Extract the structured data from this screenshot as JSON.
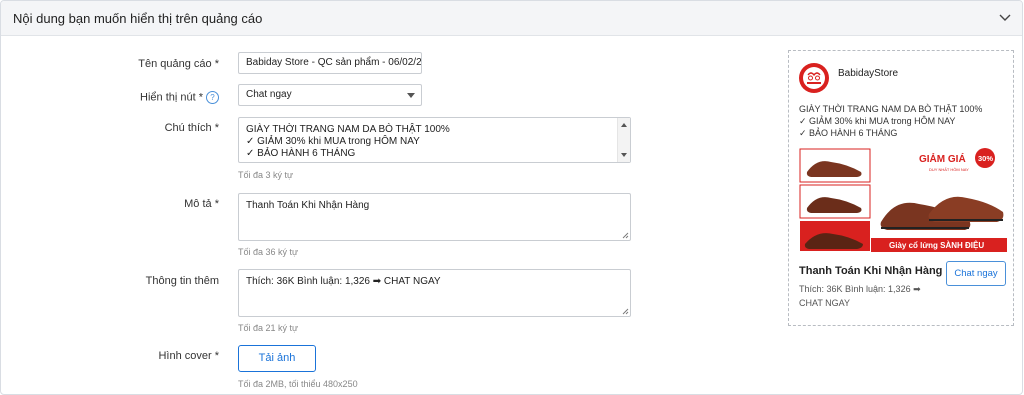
{
  "section": {
    "title": "Nội dung bạn muốn hiển thị trên quảng cáo"
  },
  "form": {
    "ad_name": {
      "label": "Tên quảng cáo *",
      "value": "Babiday Store - QC sản phẩm - 06/02/20"
    },
    "button": {
      "label": "Hiển thị nút *",
      "help": "?",
      "value": "Chat ngay"
    },
    "caption": {
      "label": "Chú thích *",
      "lines": [
        "GIÀY THỜI TRANG NAM DA BÒ THẬT 100%",
        "✓ GIẢM 30% khi MUA trong HÔM NAY",
        "✓ BẢO HÀNH 6 THÁNG"
      ],
      "hint": "Tối đa 3 ký tự"
    },
    "description": {
      "label": "Mô tả *",
      "value": "Thanh Toán Khi Nhận Hàng",
      "hint": "Tối đa 36 ký tự"
    },
    "more_info": {
      "label": "Thông tin thêm",
      "value": "Thích: 36K Bình luận: 1,326 ➡ CHAT NGAY",
      "hint": "Tối đa 21 ký tự"
    },
    "cover": {
      "label": "Hình cover *",
      "button": "Tải ảnh",
      "hint": "Tối đa 2MB, tối thiểu 480x250"
    }
  },
  "preview": {
    "store_name": "BabidayStore",
    "caption_lines": [
      "GIÀY THỜI TRANG NAM DA BÒ THẬT 100%",
      "✓ GIẢM 30% khi MUA trong HÔM NAY",
      "✓ BẢO HÀNH 6 THÁNG"
    ],
    "banner": {
      "sale": "GIẢM GIÁ",
      "percent": "30%",
      "sub": "DUY NHẤT HÔM NAY",
      "slogan": "Giày cổ lửng SÀNH ĐIỆU"
    },
    "headline": "Thanh Toán Khi Nhận Hàng",
    "description": "Thích: 36K Bình luận: 1,326 ➡ CHAT NGAY",
    "cta": "Chat ngay"
  },
  "colors": {
    "accent": "#1a73d9",
    "brand_red": "#d9211f",
    "shoe_brown": "#7a3520"
  }
}
